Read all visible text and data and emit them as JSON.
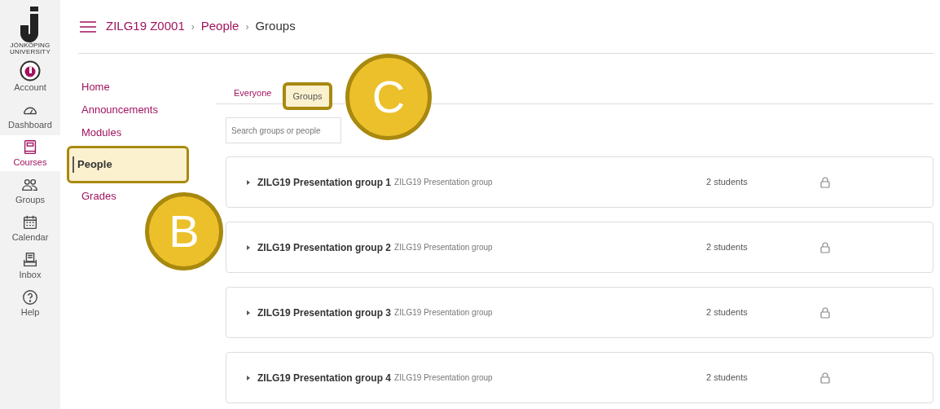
{
  "logo": {
    "line_1": "JÖNKÖPING",
    "line_2": "UNIVERSITY"
  },
  "global_nav": [
    {
      "label": "Account",
      "kind": "account",
      "selected": false
    },
    {
      "label": "Dashboard",
      "kind": "dashboard",
      "selected": false
    },
    {
      "label": "Courses",
      "kind": "courses",
      "selected": true
    },
    {
      "label": "Groups",
      "kind": "groups",
      "selected": false
    },
    {
      "label": "Calendar",
      "kind": "calendar",
      "selected": false
    },
    {
      "label": "Inbox",
      "kind": "inbox",
      "selected": false
    },
    {
      "label": "Help",
      "kind": "help",
      "selected": false
    }
  ],
  "breadcrumbs": [
    {
      "label": "ZILG19 Z0001",
      "link": true,
      "separator": "›"
    },
    {
      "label": "People",
      "link": true,
      "separator": "›"
    },
    {
      "label": "Groups",
      "link": false
    }
  ],
  "course_nav": [
    {
      "label": "Home",
      "selected": false
    },
    {
      "label": "Announcements",
      "selected": false
    },
    {
      "label": "Modules",
      "selected": false
    },
    {
      "label": "People",
      "selected": true
    },
    {
      "label": "Grades",
      "selected": false
    }
  ],
  "tabs": [
    {
      "label": "Everyone",
      "selected": false
    },
    {
      "label": "Groups",
      "selected": true
    }
  ],
  "search": {
    "placeholder": "Search groups or people"
  },
  "groups": [
    {
      "name": "ZILG19 Presentation group 1",
      "category": "ZILG19 Presentation group",
      "count": "2 students"
    },
    {
      "name": "ZILG19 Presentation group 2",
      "category": "ZILG19 Presentation group",
      "count": "2 students"
    },
    {
      "name": "ZILG19 Presentation group 3",
      "category": "ZILG19 Presentation group",
      "count": "2 students"
    },
    {
      "name": "ZILG19 Presentation group 4",
      "category": "ZILG19 Presentation group",
      "count": "2 students"
    }
  ],
  "callouts": [
    {
      "label": "B"
    },
    {
      "label": "C"
    }
  ]
}
